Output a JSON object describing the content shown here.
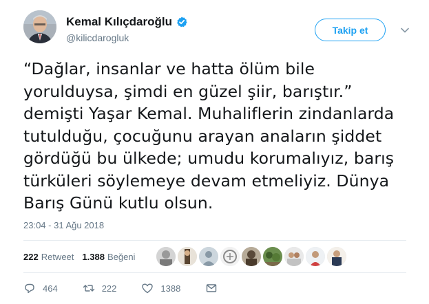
{
  "tweet": {
    "author_name": "Kemal Kılıçdaroğlu",
    "author_handle": "@kilicdarogluk",
    "follow_label": "Takip et",
    "text_lines": [
      "“Dağlar, insanlar ve hatta ölüm bile",
      "yorulduysa, şimdi en güzel şiir, barıştır.”",
      "demişti Yaşar Kemal. Muhaliflerin zindanlarda",
      "tutulduğu, çocuğunu arayan anaların şiddet",
      "gördüğü bu ülkede; umudu korumalıyız, barış",
      "türküleri söylemeye devam etmeliyiz. Dünya",
      "Barış Günü kutlu olsun."
    ],
    "timestamp": "23:04 - 31 Ağu 2018",
    "retweet_count": "222",
    "retweet_label": "Retweet",
    "like_count": "1.388",
    "like_label": "Beğeni",
    "actions": {
      "reply_count": "464",
      "retweet_count": "222",
      "like_count": "1388"
    }
  },
  "colors": {
    "accent": "#1da1f2",
    "secondary_text": "#657786",
    "divider": "#e6ecf0"
  },
  "icons": {
    "verified": "verified-badge-icon",
    "chevron": "chevron-down-icon",
    "reply": "reply-icon",
    "retweet": "retweet-icon",
    "like": "heart-icon",
    "dm": "envelope-icon"
  }
}
